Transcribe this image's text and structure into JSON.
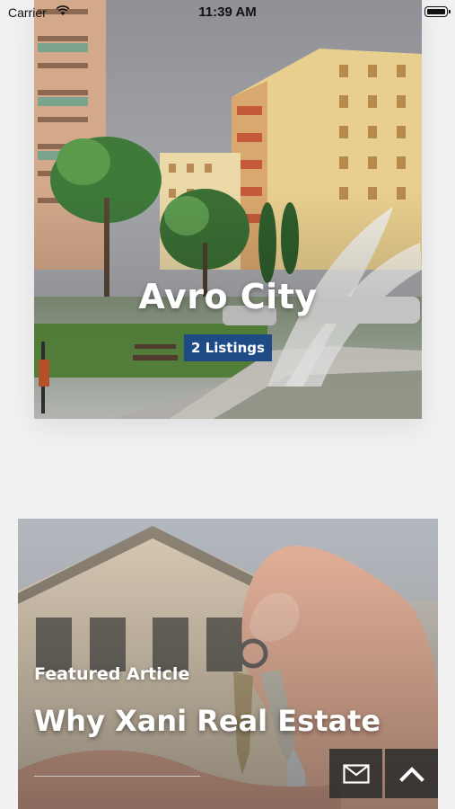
{
  "status_bar": {
    "carrier": "Carrier",
    "time": "11:39 AM"
  },
  "city_card": {
    "title": "Avro City",
    "listings": "2 Listings",
    "badge_color": "#1e4a86"
  },
  "featured_card": {
    "label": "Featured Article",
    "title": "Why Xani Real Estate"
  },
  "floating_buttons": {
    "mail_icon": "mail-icon",
    "scroll_top_icon": "chevron-up-icon"
  }
}
